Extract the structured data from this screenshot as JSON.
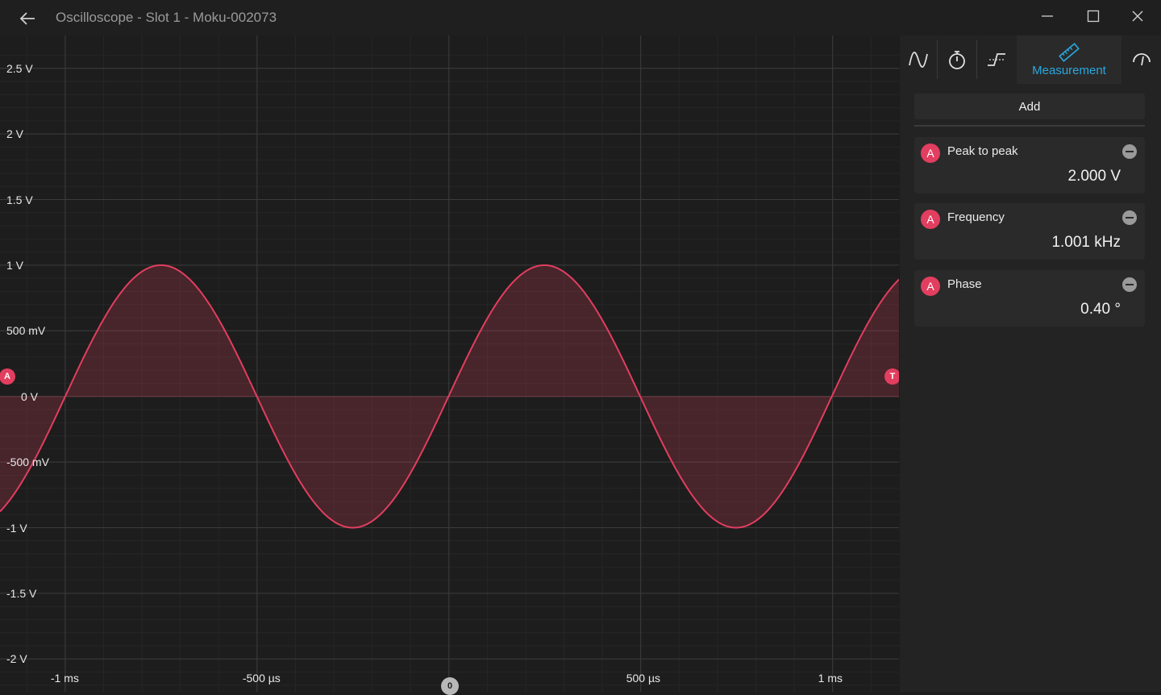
{
  "window": {
    "title": "Oscilloscope - Slot 1 - Moku-002073",
    "controls": [
      "minimize",
      "maximize",
      "close"
    ]
  },
  "plot": {
    "y_labels": [
      "2.5 V",
      "2 V",
      "1.5 V",
      "1 V",
      "500 mV",
      "0 V",
      "-500 mV",
      "-1 V",
      "-1.5 V",
      "-2 V"
    ],
    "x_labels": [
      "-1 ms",
      "-500 µs",
      "500 µs",
      "1 ms"
    ],
    "channel_marker": "A",
    "trigger_marker": "T",
    "time_origin_marker": "0",
    "trace_color": "#e23e5f"
  },
  "chart_data": {
    "type": "line",
    "title": "",
    "xlabel": "",
    "ylabel": "",
    "x_unit": "ms",
    "y_unit": "V",
    "xlim": [
      -1.17,
      1.173
    ],
    "ylim": [
      -2.25,
      2.75
    ],
    "x_ticks": [
      "-1 ms",
      "-500 µs",
      "500 µs",
      "1 ms"
    ],
    "y_ticks": [
      "2.5 V",
      "2 V",
      "1.5 V",
      "1 V",
      "500 mV",
      "0 V",
      "-500 mV",
      "-1 V",
      "-1.5 V",
      "-2 V"
    ],
    "grid": true,
    "series": [
      {
        "channel": "A",
        "waveform": "sine",
        "amplitude_V": 1.0,
        "frequency_kHz": 1.001,
        "phase_deg": 0.4,
        "offset_V": 0.0,
        "fill_to_zero": true
      }
    ]
  },
  "panel": {
    "tabs": [
      {
        "name": "waveform-tab",
        "icon": "sine-wave-icon",
        "label": ""
      },
      {
        "name": "timebase-tab",
        "icon": "stopwatch-icon",
        "label": ""
      },
      {
        "name": "trigger-tab",
        "icon": "trigger-edge-icon",
        "label": ""
      },
      {
        "name": "measurement-tab",
        "icon": "ruler-icon",
        "label": "Measurement"
      },
      {
        "name": "display-tab",
        "icon": "gauge-icon",
        "label": ""
      }
    ],
    "add_label": "Add",
    "measurements": [
      {
        "channel": "A",
        "name": "Peak to peak",
        "value": "2.000 V"
      },
      {
        "channel": "A",
        "name": "Frequency",
        "value": "1.001 kHz"
      },
      {
        "channel": "A",
        "name": "Phase",
        "value": "0.40 °"
      }
    ]
  },
  "colors": {
    "accent": "#29a8e0",
    "channel_a": "#e23e5f",
    "background": "#1c1c1c"
  }
}
